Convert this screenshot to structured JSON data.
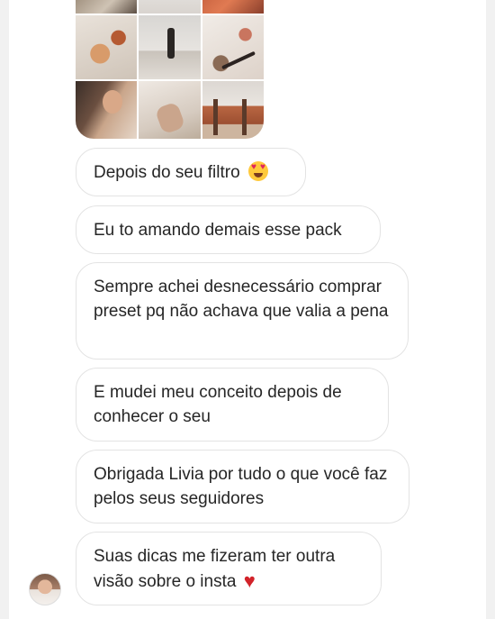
{
  "thread": {
    "shared_media": {
      "tiles": [
        "photo",
        "photo",
        "photo",
        "photo",
        "photo",
        "photo",
        "photo",
        "photo",
        "photo"
      ]
    },
    "messages": [
      {
        "text": "Depois do seu filtro",
        "emoji": "heart-eyes"
      },
      {
        "text": "Eu to amando demais esse pack"
      },
      {
        "text": "Sempre achei desnecessário comprar preset pq não achava que valia a pena"
      },
      {
        "text": "E mudei meu conceito depois de conhecer o seu"
      },
      {
        "text": "Obrigada Livia por tudo o que você faz pelos seus seguidores"
      },
      {
        "text": "Suas dicas me fizeram ter outra visão sobre o insta",
        "emoji": "red-heart"
      }
    ],
    "sender": {
      "avatar_icon": "profile-avatar"
    }
  },
  "colors": {
    "bubble_border": "#e3e3e3",
    "text": "#262626",
    "heart": "#d2232a"
  }
}
